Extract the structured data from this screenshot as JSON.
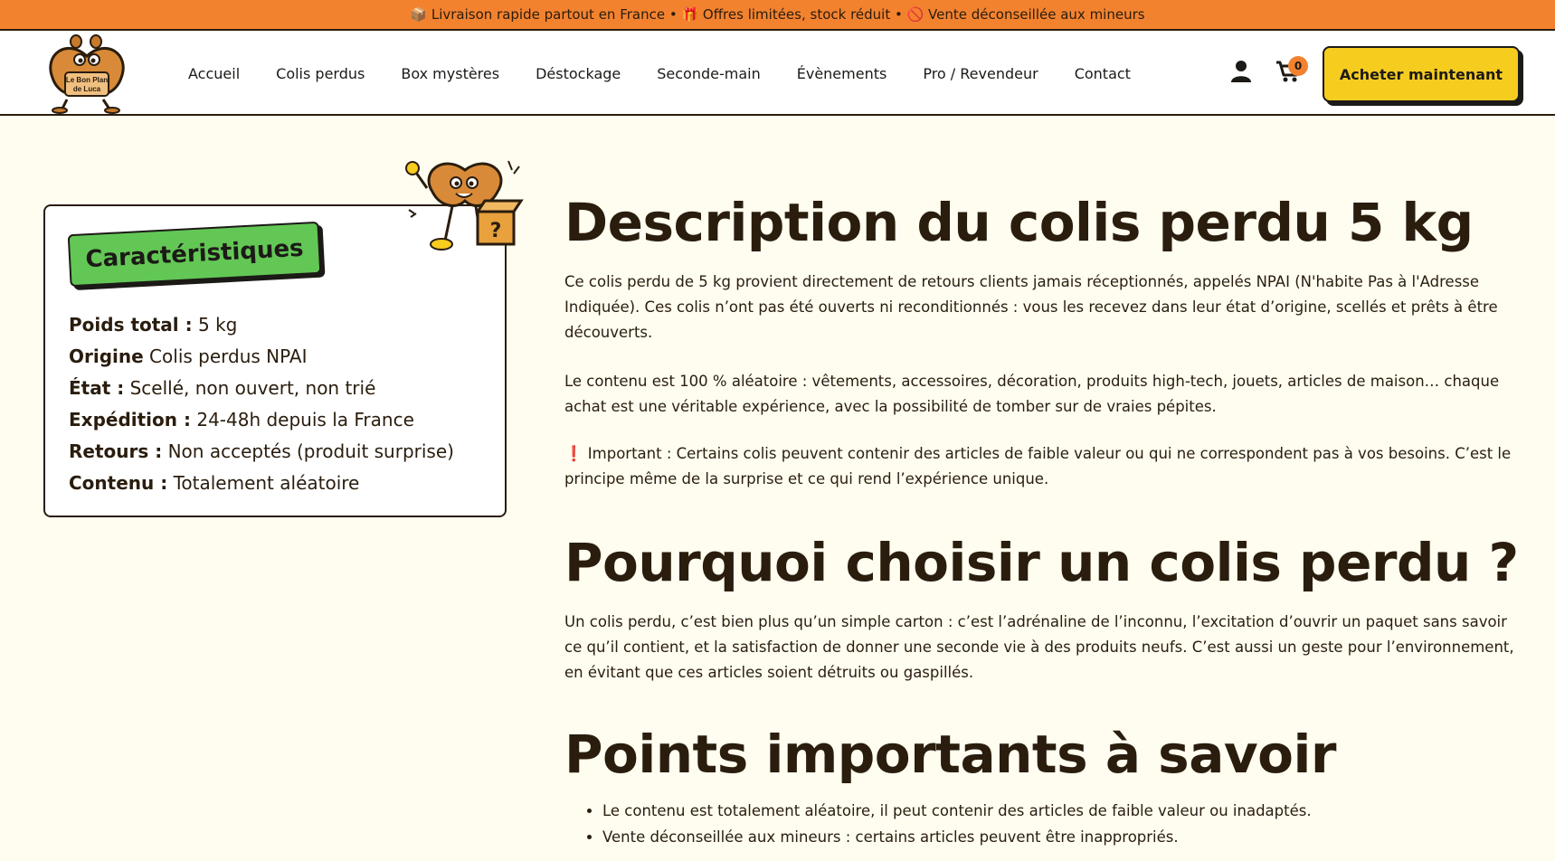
{
  "announcement": "📦 Livraison rapide partout en France • 🎁 Offres limitées, stock réduit • 🚫 Vente déconseillée aux mineurs",
  "logo": {
    "line1": "Le Bon Plan",
    "line2": "de Luca"
  },
  "nav": [
    "Accueil",
    "Colis perdus",
    "Box mystères",
    "Déstockage",
    "Seconde-main",
    "Évènements",
    "Pro / Revendeur",
    "Contact"
  ],
  "cart_count": "0",
  "buy_button": "Acheter maintenant",
  "card": {
    "tag": "Caractéristiques",
    "specs": [
      {
        "k": "Poids total :",
        "v": " 5 kg"
      },
      {
        "k": "Origine",
        "v": " Colis perdus NPAI"
      },
      {
        "k": "État :",
        "v": " Scellé, non ouvert, non trié"
      },
      {
        "k": "Expédition :",
        "v": " 24-48h depuis la France"
      },
      {
        "k": "Retours :",
        "v": " Non acceptés (produit surprise)"
      },
      {
        "k": "Contenu :",
        "v": " Totalement aléatoire"
      }
    ]
  },
  "section1": {
    "title": "Description du colis perdu 5 kg",
    "p1": "Ce colis perdu de 5 kg provient directement de retours clients jamais réceptionnés, appelés NPAI (N'habite Pas à l'Adresse Indiquée). Ces colis n’ont pas été ouverts ni reconditionnés : vous les recevez dans leur état d’origine, scellés et prêts à être découverts.",
    "p2": "Le contenu est 100 % aléatoire : vêtements, accessoires, décoration, produits high-tech, jouets, articles de maison… chaque achat est une véritable expérience, avec la possibilité de tomber sur de vraies pépites.",
    "p3": "❗ Important : Certains colis peuvent contenir des articles de faible valeur ou qui ne correspondent pas à vos besoins. C’est le principe même de la surprise et ce qui rend l’expérience unique."
  },
  "section2": {
    "title": "Pourquoi choisir un colis perdu ?",
    "p1": "Un colis perdu, c’est bien plus qu’un simple carton : c’est l’adrénaline de l’inconnu, l’excitation d’ouvrir un paquet sans savoir ce qu’il contient, et la satisfaction de donner une seconde vie à des produits neufs. C’est aussi un geste pour l’environnement, en évitant que ces articles soient détruits ou gaspillés."
  },
  "section3": {
    "title": "Points importants à savoir",
    "bullets": [
      "Le contenu est totalement aléatoire, il peut contenir des articles de faible valeur ou inadaptés.",
      "Vente déconseillée aux mineurs : certains articles peuvent être inappropriés."
    ]
  },
  "colors": {
    "accent_orange": "#f3822f",
    "button_yellow": "#f6cc1f",
    "tag_green": "#63c755",
    "text_dark": "#2a1d0e",
    "page_bg": "#fefdf0"
  }
}
